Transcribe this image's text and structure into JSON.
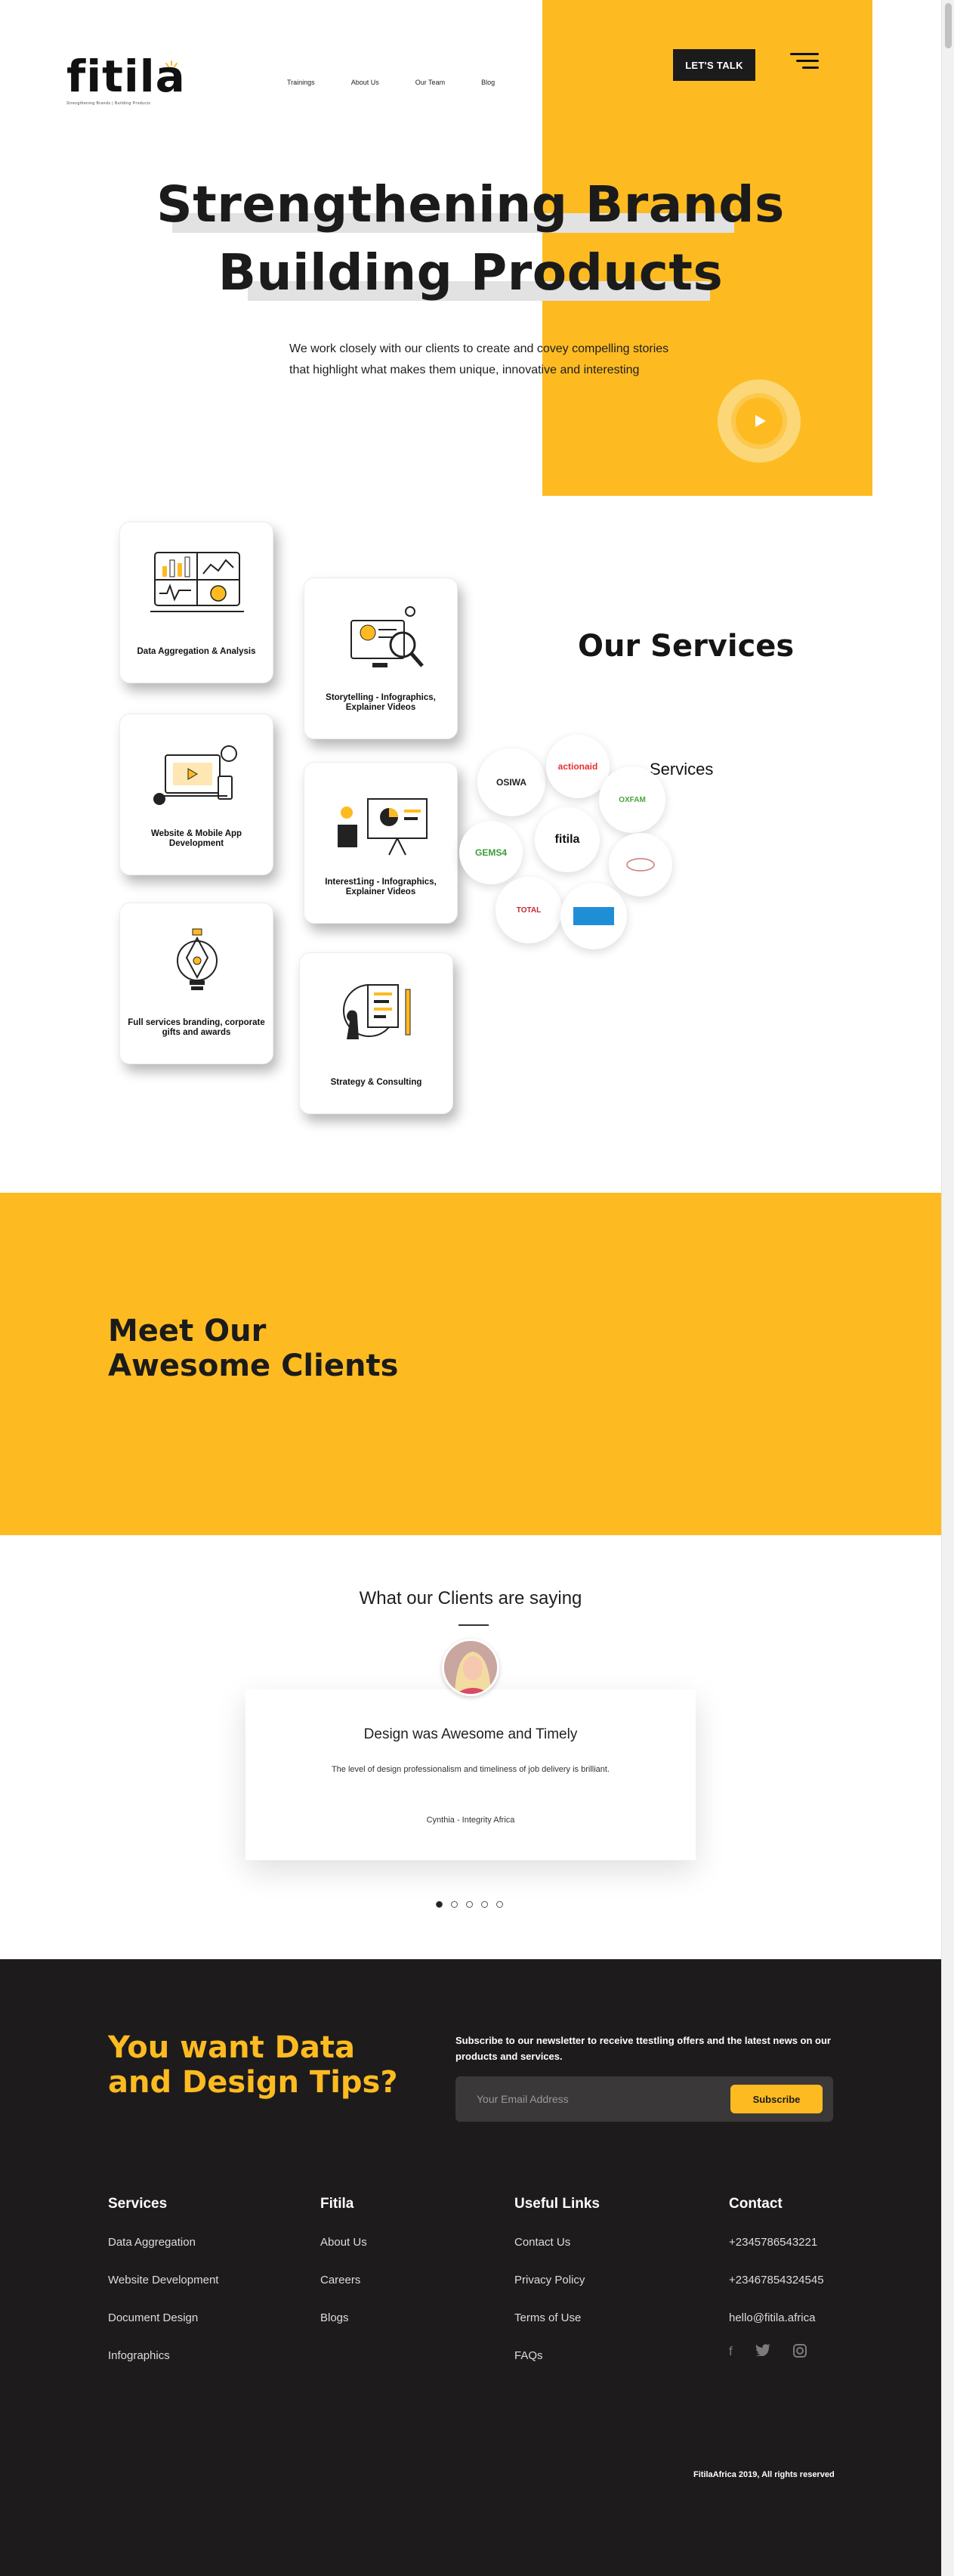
{
  "brand": {
    "logo_text": "fitila",
    "tagline": "Strengthening Brands | Building Products"
  },
  "nav": {
    "items": [
      "Trainings",
      "About Us",
      "Our Team",
      "Blog"
    ],
    "cta_label": "LET'S TALK"
  },
  "hero": {
    "headline_line1": "Strengthening Brands",
    "headline_line2": "Building Products",
    "intro_line1": "We work closely with our clients to create and covey compelling stories",
    "intro_line2": "that highlight what makes them unique, innovative and interesting"
  },
  "services": {
    "title": "Our Services",
    "ghost_title": "Services",
    "cards": [
      {
        "label": "Data Aggregation & Analysis"
      },
      {
        "label": "Storytelling - Infographics, Explainer Videos"
      },
      {
        "label": "Website & Mobile App Development"
      },
      {
        "label": "Interest1ing - Infographics, Explainer Videos"
      },
      {
        "label": "Full services branding, corporate gifts and awards"
      },
      {
        "label": "Strategy & Consulting"
      }
    ],
    "client_logos": [
      "OSIWA",
      "actionaid",
      "OXFAM",
      "GEMS4",
      "fitila",
      "TOTAL"
    ]
  },
  "clients": {
    "title_line1": "Meet Our",
    "title_line2": "Awesome Clients"
  },
  "testimonials": {
    "title": "What our Clients are saying",
    "heading": "Design was Awesome and Timely",
    "body": "The level of design professionalism and timeliness of job delivery is brilliant.",
    "author": "Cynthia - Integrity Africa",
    "active_slide": 1,
    "slide_count": 5
  },
  "footer": {
    "tips_line1": "You want Data",
    "tips_line2": "and Design Tips?",
    "newsletter_text": "Subscribe to our newsletter to receive ttestling offers and the latest news on our products and services.",
    "email_placeholder": "Your Email Address",
    "subscribe_label": "Subscribe",
    "columns": [
      {
        "title": "Services",
        "links": [
          "Data Aggregation",
          "Website Development",
          "Document Design",
          "Infographics"
        ]
      },
      {
        "title": "Fitila",
        "links": [
          "About Us",
          "Careers",
          "Blogs"
        ]
      },
      {
        "title": "Useful Links",
        "links": [
          "Contact Us",
          "Privacy Policy",
          "Terms of Use",
          "FAQs"
        ]
      },
      {
        "title": "Contact",
        "links": [
          "+2345786543221",
          "+23467854324545",
          "hello@fitila.africa"
        ]
      }
    ],
    "social": [
      "facebook-icon",
      "twitter-icon",
      "instagram-icon"
    ],
    "copyright": "FitilaAfrica 2019, All rights reserved"
  },
  "colors": {
    "accent": "#fdbb21",
    "dark": "#1d1b1c"
  }
}
